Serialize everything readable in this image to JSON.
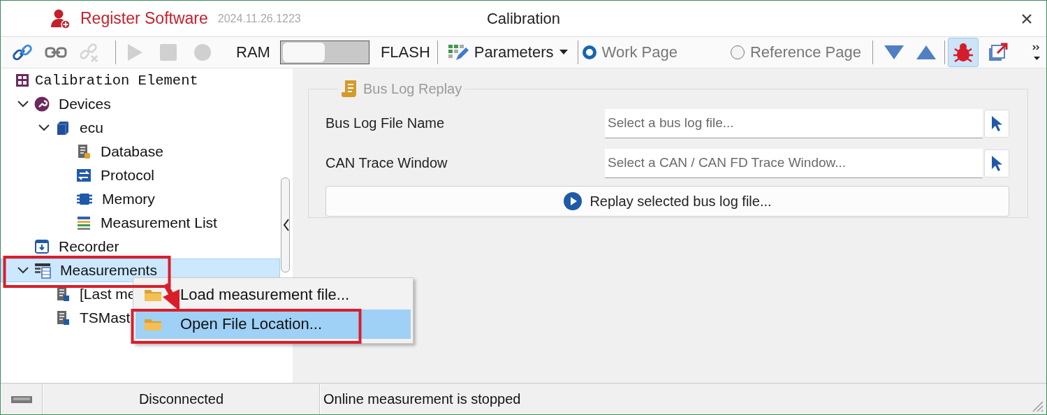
{
  "window": {
    "app_name": "Register Software",
    "version": "2024.11.26.1223",
    "title": "Calibration"
  },
  "toolbar": {
    "connect_buttons": [
      {
        "disabled": false
      },
      {
        "disabled": false
      },
      {
        "disabled": true
      }
    ],
    "run_buttons": [
      {
        "disabled": true
      },
      {
        "disabled": true
      },
      {
        "disabled": true
      }
    ],
    "ram_label": "RAM",
    "memory_switch": {
      "on": false
    },
    "flash_label": "FLASH",
    "parameters_menu": {
      "label": "Parameters"
    },
    "pages": [
      {
        "label": "Work Page",
        "selected": true
      },
      {
        "label": "Reference Page",
        "selected": false
      }
    ],
    "debug_button": {
      "pressed": true
    }
  },
  "tree": {
    "title": "Calibration Element",
    "items": [
      {
        "kind": "devices",
        "label": "Devices",
        "expanded": true,
        "selected": false,
        "children": [
          {
            "kind": "ecu",
            "label": "ecu",
            "expanded": true,
            "selected": false,
            "children": [
              {
                "kind": "database",
                "label": "Database",
                "selected": false
              },
              {
                "kind": "protocol",
                "label": "Protocol",
                "selected": false
              },
              {
                "kind": "memory",
                "label": "Memory",
                "selected": false
              },
              {
                "kind": "list",
                "label": "Measurement List",
                "selected": false
              }
            ]
          }
        ]
      },
      {
        "kind": "recorder",
        "label": "Recorder",
        "selected": false
      },
      {
        "kind": "measurements",
        "label": "Measurements",
        "expanded": true,
        "selected": true,
        "children": [
          {
            "kind": "file",
            "label": "[Last me",
            "selected": false
          },
          {
            "kind": "file",
            "label": "TSMast",
            "selected": false
          }
        ]
      }
    ]
  },
  "replay_panel": {
    "title": "Bus Log Replay",
    "fields": [
      {
        "label": "Bus Log File Name",
        "placeholder": "Select a bus log file..."
      },
      {
        "label": "CAN Trace Window",
        "placeholder": "Select a CAN / CAN FD Trace Window..."
      }
    ],
    "replay_button": "Replay selected bus log file..."
  },
  "context_menu": {
    "items": [
      {
        "label": "Load measurement file...",
        "selected": false
      },
      {
        "label": "Open File Location...",
        "selected": true
      }
    ]
  },
  "status_bar": {
    "connection": "Disconnected",
    "message": "Online measurement is stopped"
  }
}
